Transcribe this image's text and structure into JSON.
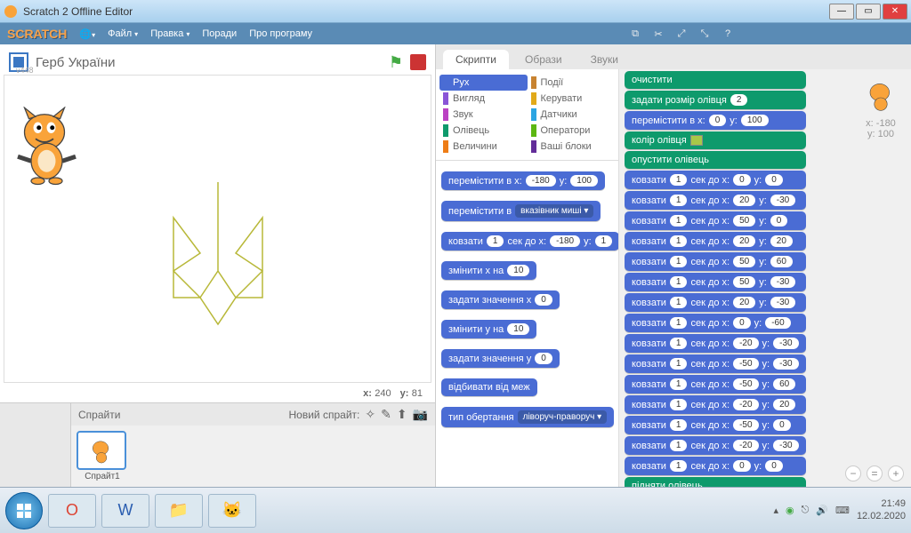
{
  "window": {
    "title": "Scratch 2 Offline Editor"
  },
  "menu": {
    "file": "Файл",
    "edit": "Правка",
    "tips": "Поради",
    "about": "Про програму"
  },
  "project": {
    "title": "Герб України",
    "version": "v448"
  },
  "stage": {
    "coords_x_label": "x:",
    "coords_x": "240",
    "coords_y_label": "y:",
    "coords_y": "81"
  },
  "sprites": {
    "panel_label": "Спрайти",
    "new_label": "Новий спрайт:",
    "sprite1": "Спрайт1"
  },
  "tabs": {
    "scripts": "Скрипти",
    "costumes": "Образи",
    "sounds": "Звуки"
  },
  "categories": {
    "motion": "Рух",
    "looks": "Вигляд",
    "sound": "Звук",
    "pen": "Олівець",
    "data": "Величини",
    "events": "Події",
    "control": "Керувати",
    "sensing": "Датчики",
    "operators": "Оператори",
    "more": "Ваші блоки"
  },
  "palette_blocks": [
    {
      "t": "перемістити в x:",
      "a": "-180",
      "m": "y:",
      "b": "100"
    },
    {
      "t": "перемістити в",
      "d": "вказівник миші"
    },
    {
      "t": "ковзати",
      "a": "1",
      "m": "сек до x:",
      "b": "-180",
      "n": "y:",
      "c": "1"
    },
    {
      "t": "змінити x на",
      "a": "10"
    },
    {
      "t": "задати значення x",
      "a": "0"
    },
    {
      "t": "змінити y на",
      "a": "10"
    },
    {
      "t": "задати значення y",
      "a": "0"
    },
    {
      "t": "відбивати від меж"
    },
    {
      "t": "тип обертання",
      "d": "ліворуч-праворуч"
    }
  ],
  "script": {
    "xy_label": {
      "x": "x: -180",
      "y": "y: 100"
    },
    "blocks": [
      {
        "k": "g",
        "t": "очистити"
      },
      {
        "k": "g",
        "t": "задати розмір олівця",
        "a": "2"
      },
      {
        "k": "b",
        "t": "перемістити в x:",
        "a": "0",
        "m": "y:",
        "b": "100"
      },
      {
        "k": "g",
        "t": "колір олівця",
        "sq": true
      },
      {
        "k": "g",
        "t": "опустити олівець"
      },
      {
        "k": "b",
        "t": "ковзати",
        "a": "1",
        "m": "сек до x:",
        "b": "0",
        "n": "y:",
        "c": "0"
      },
      {
        "k": "b",
        "t": "ковзати",
        "a": "1",
        "m": "сек до x:",
        "b": "20",
        "n": "y:",
        "c": "-30"
      },
      {
        "k": "b",
        "t": "ковзати",
        "a": "1",
        "m": "сек до x:",
        "b": "50",
        "n": "y:",
        "c": "0"
      },
      {
        "k": "b",
        "t": "ковзати",
        "a": "1",
        "m": "сек до x:",
        "b": "20",
        "n": "y:",
        "c": "20"
      },
      {
        "k": "b",
        "t": "ковзати",
        "a": "1",
        "m": "сек до x:",
        "b": "50",
        "n": "y:",
        "c": "60"
      },
      {
        "k": "b",
        "t": "ковзати",
        "a": "1",
        "m": "сек до x:",
        "b": "50",
        "n": "y:",
        "c": "-30"
      },
      {
        "k": "b",
        "t": "ковзати",
        "a": "1",
        "m": "сек до x:",
        "b": "20",
        "n": "y:",
        "c": "-30"
      },
      {
        "k": "b",
        "t": "ковзати",
        "a": "1",
        "m": "сек до x:",
        "b": "0",
        "n": "y:",
        "c": "-60"
      },
      {
        "k": "b",
        "t": "ковзати",
        "a": "1",
        "m": "сек до x:",
        "b": "-20",
        "n": "y:",
        "c": "-30"
      },
      {
        "k": "b",
        "t": "ковзати",
        "a": "1",
        "m": "сек до x:",
        "b": "-50",
        "n": "y:",
        "c": "-30"
      },
      {
        "k": "b",
        "t": "ковзати",
        "a": "1",
        "m": "сек до x:",
        "b": "-50",
        "n": "y:",
        "c": "60"
      },
      {
        "k": "b",
        "t": "ковзати",
        "a": "1",
        "m": "сек до x:",
        "b": "-20",
        "n": "y:",
        "c": "20"
      },
      {
        "k": "b",
        "t": "ковзати",
        "a": "1",
        "m": "сек до x:",
        "b": "-50",
        "n": "y:",
        "c": "0"
      },
      {
        "k": "b",
        "t": "ковзати",
        "a": "1",
        "m": "сек до x:",
        "b": "-20",
        "n": "y:",
        "c": "-30"
      },
      {
        "k": "b",
        "t": "ковзати",
        "a": "1",
        "m": "сек до x:",
        "b": "0",
        "n": "y:",
        "c": "0"
      },
      {
        "k": "g",
        "t": "підняти олівець"
      }
    ]
  },
  "taskbar": {
    "time": "21:49",
    "date": "12.02.2020"
  }
}
